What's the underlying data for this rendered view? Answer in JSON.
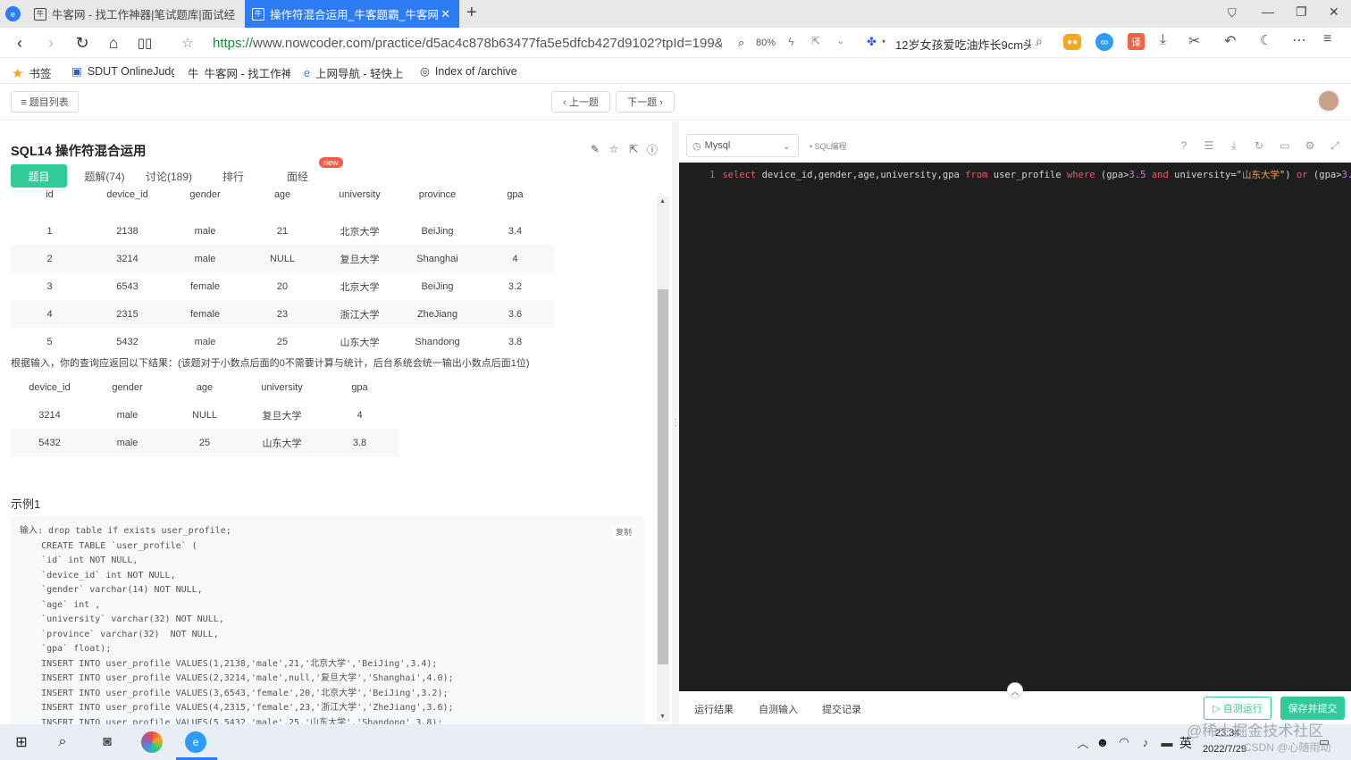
{
  "browser": {
    "tabs": [
      {
        "title": "牛客网 - 找工作神器|笔试题库|面试经",
        "active": false
      },
      {
        "title": "操作符混合运用_牛客题霸_牛客网",
        "active": true
      }
    ],
    "url_scheme": "https://",
    "url_rest": "www.nowcoder.com/practice/d5ac4c878b63477fa5e5dfcb427d9102?tpId=199&",
    "zoom": "80%",
    "search_text": "12岁女孩爱吃油炸长9cm头",
    "bookmarks": [
      "书签",
      "SDUT OnlineJudge",
      "牛客网 - 找工作神",
      "上网导航 - 轻快上",
      "Index of /archive"
    ]
  },
  "header": {
    "list_button": "≡ 题目列表",
    "prev_button": "‹ 上一题",
    "next_button": "下一题 ›"
  },
  "question": {
    "title": "SQL14  操作符混合运用",
    "tabs": [
      "题目",
      "题解(74)",
      "讨论(189)",
      "排行",
      "面经"
    ],
    "new_badge": "new",
    "table1": {
      "headers": [
        "id",
        "device_id",
        "gender",
        "age",
        "university",
        "province",
        "gpa"
      ],
      "rows": [
        [
          "1",
          "2138",
          "male",
          "21",
          "北京大学",
          "BeiJing",
          "3.4"
        ],
        [
          "2",
          "3214",
          "male",
          "NULL",
          "复旦大学",
          "Shanghai",
          "4"
        ],
        [
          "3",
          "6543",
          "female",
          "20",
          "北京大学",
          "BeiJing",
          "3.2"
        ],
        [
          "4",
          "2315",
          "female",
          "23",
          "浙江大学",
          "ZheJiang",
          "3.6"
        ],
        [
          "5",
          "5432",
          "male",
          "25",
          "山东大学",
          "Shandong",
          "3.8"
        ]
      ]
    },
    "note": "根据输入，你的查询应返回以下结果：(该题对于小数点后面的0不需要计算与统计，后台系统会统一输出小数点后面1位)",
    "table2": {
      "headers": [
        "device_id",
        "gender",
        "age",
        "university",
        "gpa"
      ],
      "rows": [
        [
          "3214",
          "male",
          "NULL",
          "复旦大学",
          "4"
        ],
        [
          "5432",
          "male",
          "25",
          "山东大学",
          "3.8"
        ]
      ]
    },
    "example_title": "示例1",
    "copy_label": "复制",
    "example_code": "输入: drop table if exists user_profile;\n    CREATE TABLE `user_profile` (\n    `id` int NOT NULL,\n    `device_id` int NOT NULL,\n    `gender` varchar(14) NOT NULL,\n    `age` int ,\n    `university` varchar(32) NOT NULL,\n    `province` varchar(32)  NOT NULL,\n    `gpa` float);\n    INSERT INTO user_profile VALUES(1,2138,'male',21,'北京大学','BeiJing',3.4);\n    INSERT INTO user_profile VALUES(2,3214,'male',null,'复旦大学','Shanghai',4.0);\n    INSERT INTO user_profile VALUES(3,6543,'female',20,'北京大学','BeiJing',3.2);\n    INSERT INTO user_profile VALUES(4,2315,'female',23,'浙江大学','ZheJiang',3.6);\n    INSERT INTO user_profile VALUES(5,5432,'male',25,'山东大学','Shandong',3.8);"
  },
  "editor": {
    "language": "Mysql",
    "mode_tag": "• SQL编程",
    "line_number": "1",
    "code_parts": {
      "kw_select": "select",
      "cols": " device_id,gender,age,university,gpa ",
      "kw_from": "from",
      "table": " user_profile ",
      "kw_where": "where",
      "cond1a": " (gpa>",
      "num1": "3.5",
      "sp1": " ",
      "kw_and1": "and",
      "cond1b": " university=\"",
      "str1": "山东大学",
      "cond1c": "\") ",
      "kw_or": "or",
      "cond2a": " (gpa>",
      "num2": "3.8",
      "sp2": " ",
      "kw_and2": "an"
    },
    "bottom_tabs": [
      "运行结果",
      "自测输入",
      "提交记录"
    ],
    "run_button": "▷ 自测运行",
    "submit_button": "保存并提交"
  },
  "taskbar": {
    "ime": "英",
    "time": "23:34",
    "date": "2022/7/29",
    "watermark": "@稀土掘金技术社区",
    "watermark2": "CSDN @心随雨动"
  },
  "colors": {
    "accent": "#32ca99",
    "tab_active": "#2d7cf6",
    "editor_bg": "#1e1e1e",
    "keyword": "#f0556b",
    "number": "#c583e6",
    "string": "#f0a24a"
  }
}
